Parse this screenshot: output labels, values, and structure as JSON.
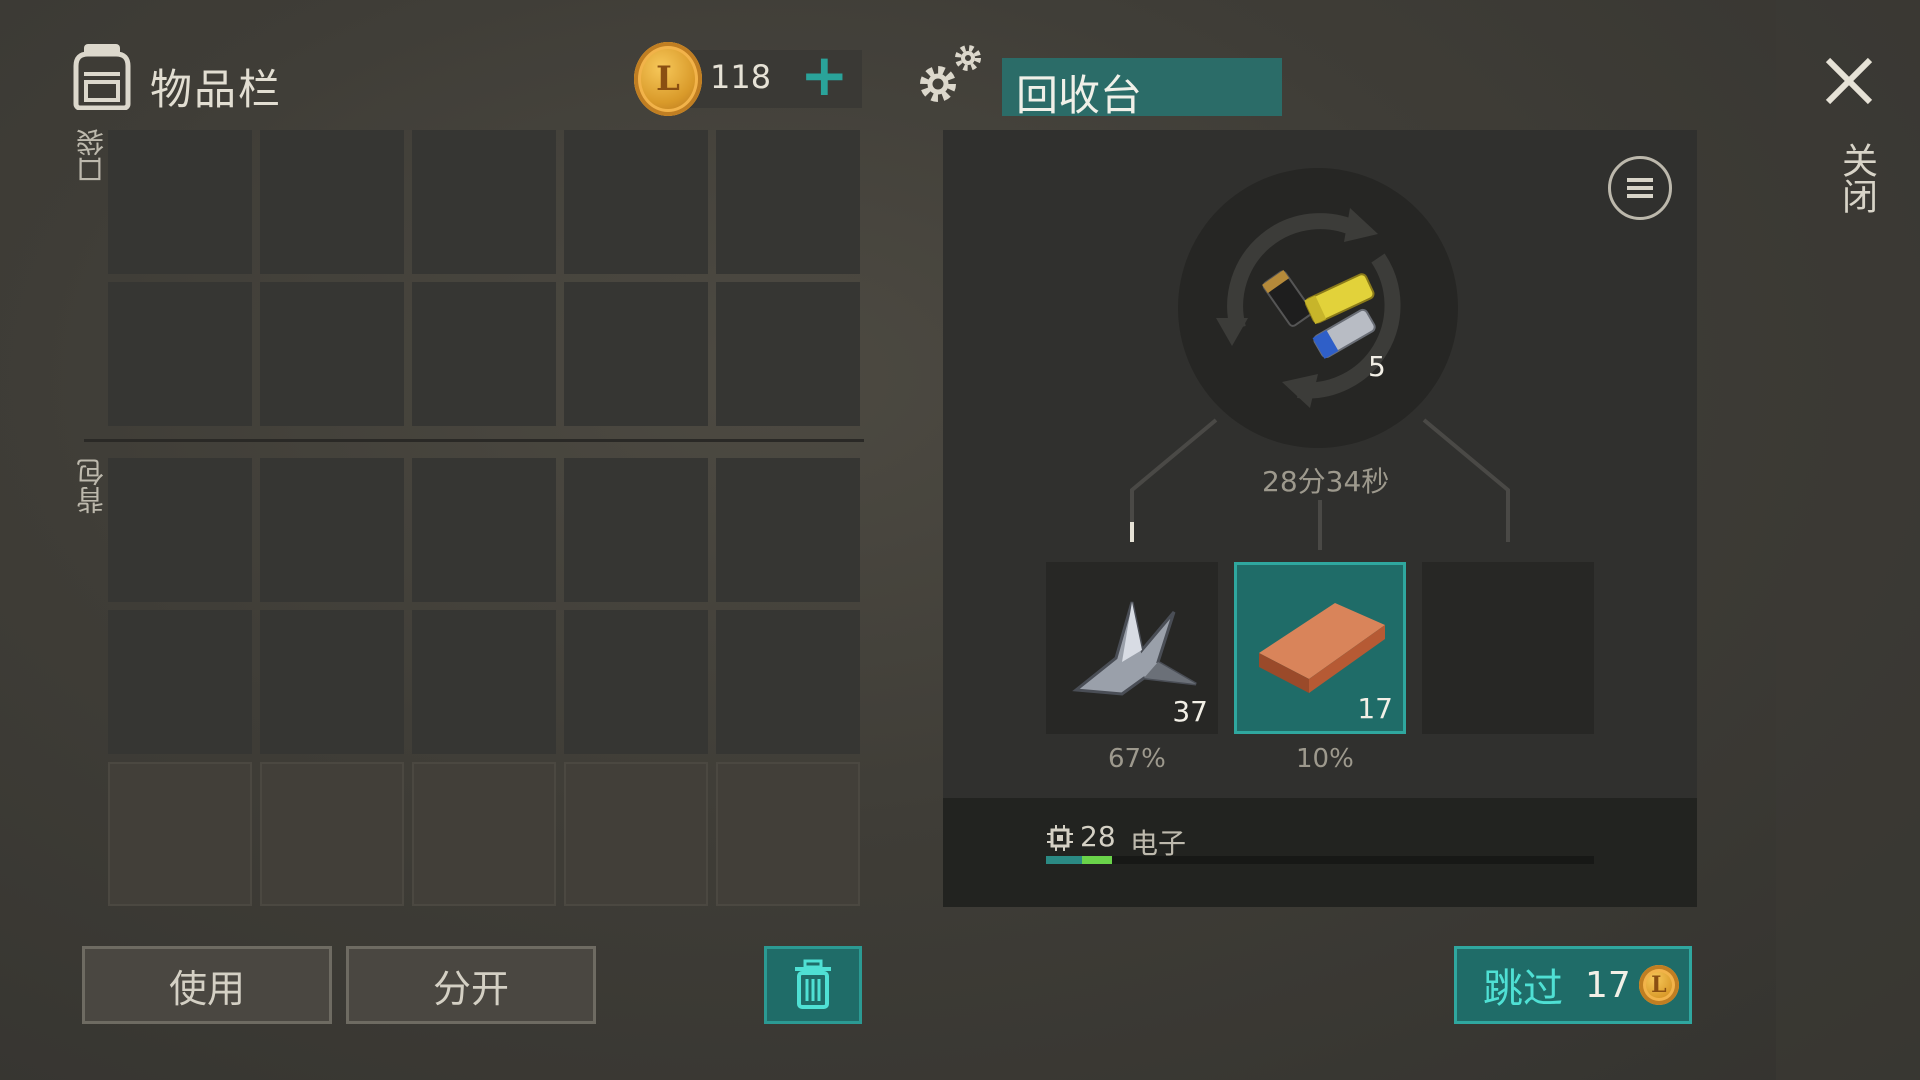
{
  "inventory": {
    "title": "物品栏",
    "coins": "118",
    "coin_symbol": "L",
    "plus_label": "+",
    "pocket_label": "口袋",
    "backpack_label": "背包",
    "use_button": "使用",
    "split_button": "分开"
  },
  "recycler": {
    "title": "回收台",
    "input_count": "5",
    "timer": "28分34秒",
    "outputs": [
      {
        "item_icon": "scrap-metal-icon",
        "count": "37",
        "chance": "67%"
      },
      {
        "item_icon": "copper-ingot-icon",
        "count": "17",
        "chance": "10%",
        "selected": true
      },
      {
        "item_icon": "",
        "count": "",
        "chance": ""
      }
    ],
    "component_count": "28",
    "component_label": "电子",
    "component_progress": 0.12
  },
  "skip": {
    "label": "跳过",
    "cost": "17",
    "coin_symbol": "L"
  },
  "close": {
    "label": "关闭"
  },
  "colors": {
    "accent_teal": "#1f6c68",
    "accent_teal_border": "#2fa79f",
    "coin_gold": "#d99a2a",
    "progress_green": "#6ad34a"
  }
}
